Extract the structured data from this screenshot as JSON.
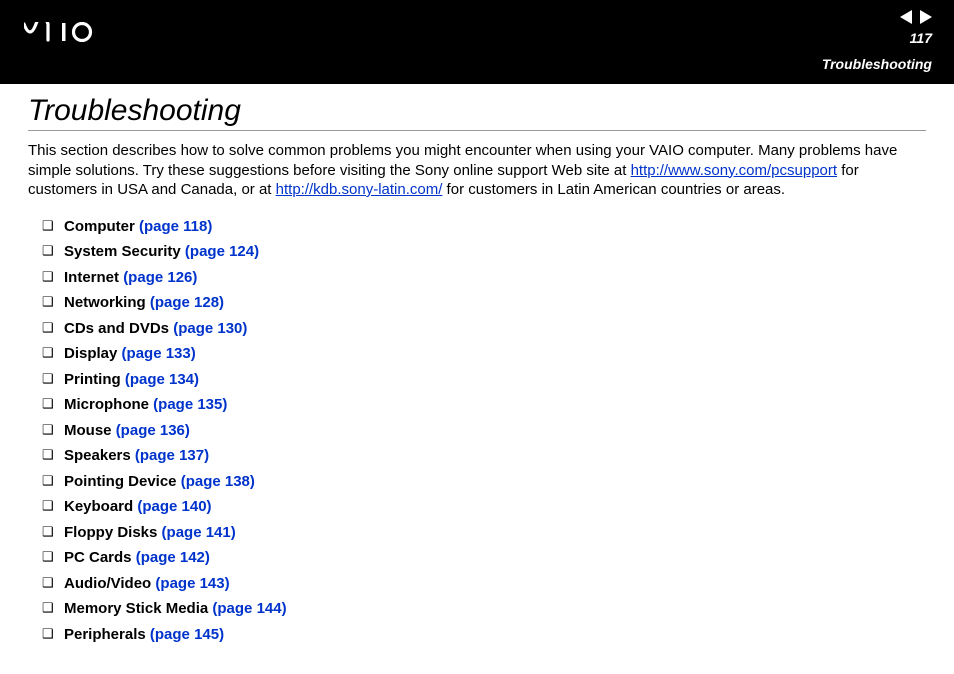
{
  "header": {
    "page_number": "117",
    "section": "Troubleshooting"
  },
  "title": "Troubleshooting",
  "intro": {
    "part1": "This section describes how to solve common problems you might encounter when using your VAIO computer. Many problems have simple solutions. Try these suggestions before visiting the Sony online support Web site at ",
    "link1": "http://www.sony.com/pcsupport",
    "part2": " for customers in USA and Canada, or at ",
    "link2": "http://kdb.sony-latin.com/",
    "part3": " for customers in Latin American countries or areas."
  },
  "topics": [
    {
      "label": "Computer",
      "page": "(page 118)"
    },
    {
      "label": "System Security",
      "page": "(page 124)"
    },
    {
      "label": "Internet",
      "page": "(page 126)"
    },
    {
      "label": "Networking",
      "page": "(page 128)"
    },
    {
      "label": "CDs and DVDs",
      "page": "(page 130)"
    },
    {
      "label": "Display",
      "page": "(page 133)"
    },
    {
      "label": "Printing",
      "page": "(page 134)"
    },
    {
      "label": "Microphone",
      "page": "(page 135)"
    },
    {
      "label": "Mouse",
      "page": "(page 136)"
    },
    {
      "label": "Speakers",
      "page": "(page 137)"
    },
    {
      "label": "Pointing Device",
      "page": "(page 138)"
    },
    {
      "label": "Keyboard",
      "page": "(page 140)"
    },
    {
      "label": "Floppy Disks",
      "page": "(page 141)"
    },
    {
      "label": "PC Cards",
      "page": "(page 142)"
    },
    {
      "label": "Audio/Video",
      "page": "(page 143)"
    },
    {
      "label": "Memory Stick Media",
      "page": "(page 144)"
    },
    {
      "label": "Peripherals",
      "page": "(page 145)"
    }
  ]
}
